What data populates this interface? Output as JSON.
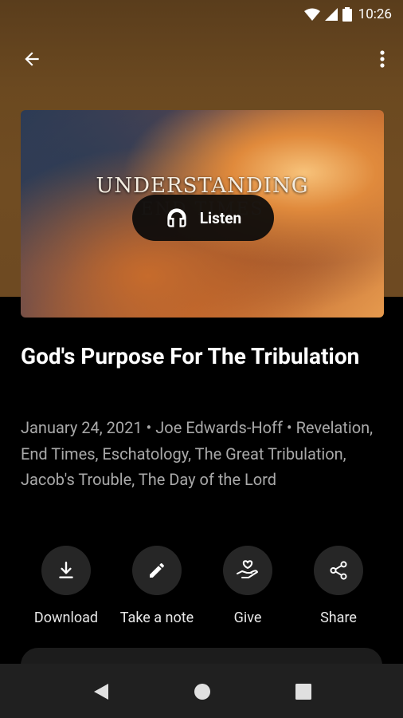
{
  "status_bar": {
    "time": "10:26",
    "icons": [
      "wifi-icon",
      "signal-icon",
      "battery-icon"
    ]
  },
  "app_bar": {
    "back_icon": "arrow-back-icon",
    "menu_icon": "more-vert-icon"
  },
  "hero": {
    "title_text": "UNDERSTANDING",
    "subtitle_text": "END TIMES",
    "listen_label": "Listen",
    "listen_icon": "headphones-icon"
  },
  "sermon": {
    "title": "God's Purpose For The Tribulation",
    "meta": "January 24, 2021 • Joe Edwards-Hoff • Revelation, End Times, Eschatology, The Great Tribulation, Jacob's Trouble, The Day of the Lord"
  },
  "actions": [
    {
      "label": "Download",
      "icon": "download-icon"
    },
    {
      "label": "Take a note",
      "icon": "pencil-icon"
    },
    {
      "label": "Give",
      "icon": "give-hand-heart-icon"
    },
    {
      "label": "Share",
      "icon": "share-icon"
    }
  ],
  "nav_bar": {
    "icons": [
      "nav-back-icon",
      "nav-home-icon",
      "nav-recents-icon"
    ]
  },
  "colors": {
    "header_brown": "#6b4920",
    "background": "#000000",
    "meta_gray": "#a9a9a9",
    "action_circle": "#262626"
  }
}
